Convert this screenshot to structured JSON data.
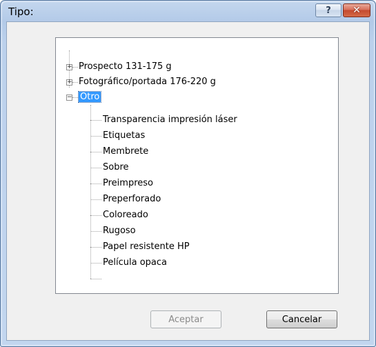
{
  "window": {
    "title": "Tipo:",
    "help_label": "?",
    "close_label": "✕"
  },
  "tree": {
    "items": [
      {
        "label": "Prospecto 131-175 g",
        "expander": "+"
      },
      {
        "label": "Fotográfico/portada 176-220 g",
        "expander": "+"
      },
      {
        "label": "Otro",
        "expander": "−",
        "selected": true
      },
      {
        "label": "Transparencia impresión láser"
      },
      {
        "label": "Etiquetas"
      },
      {
        "label": "Membrete"
      },
      {
        "label": "Sobre"
      },
      {
        "label": "Preimpreso"
      },
      {
        "label": "Preperforado"
      },
      {
        "label": "Coloreado"
      },
      {
        "label": "Rugoso"
      },
      {
        "label": "Papel resistente HP"
      },
      {
        "label": "Película opaca"
      }
    ]
  },
  "buttons": {
    "ok_label": "Aceptar",
    "cancel_label": "Cancelar"
  },
  "icons": {
    "scroll_up": "triangle-up-icon",
    "scroll_down": "triangle-down-icon"
  }
}
